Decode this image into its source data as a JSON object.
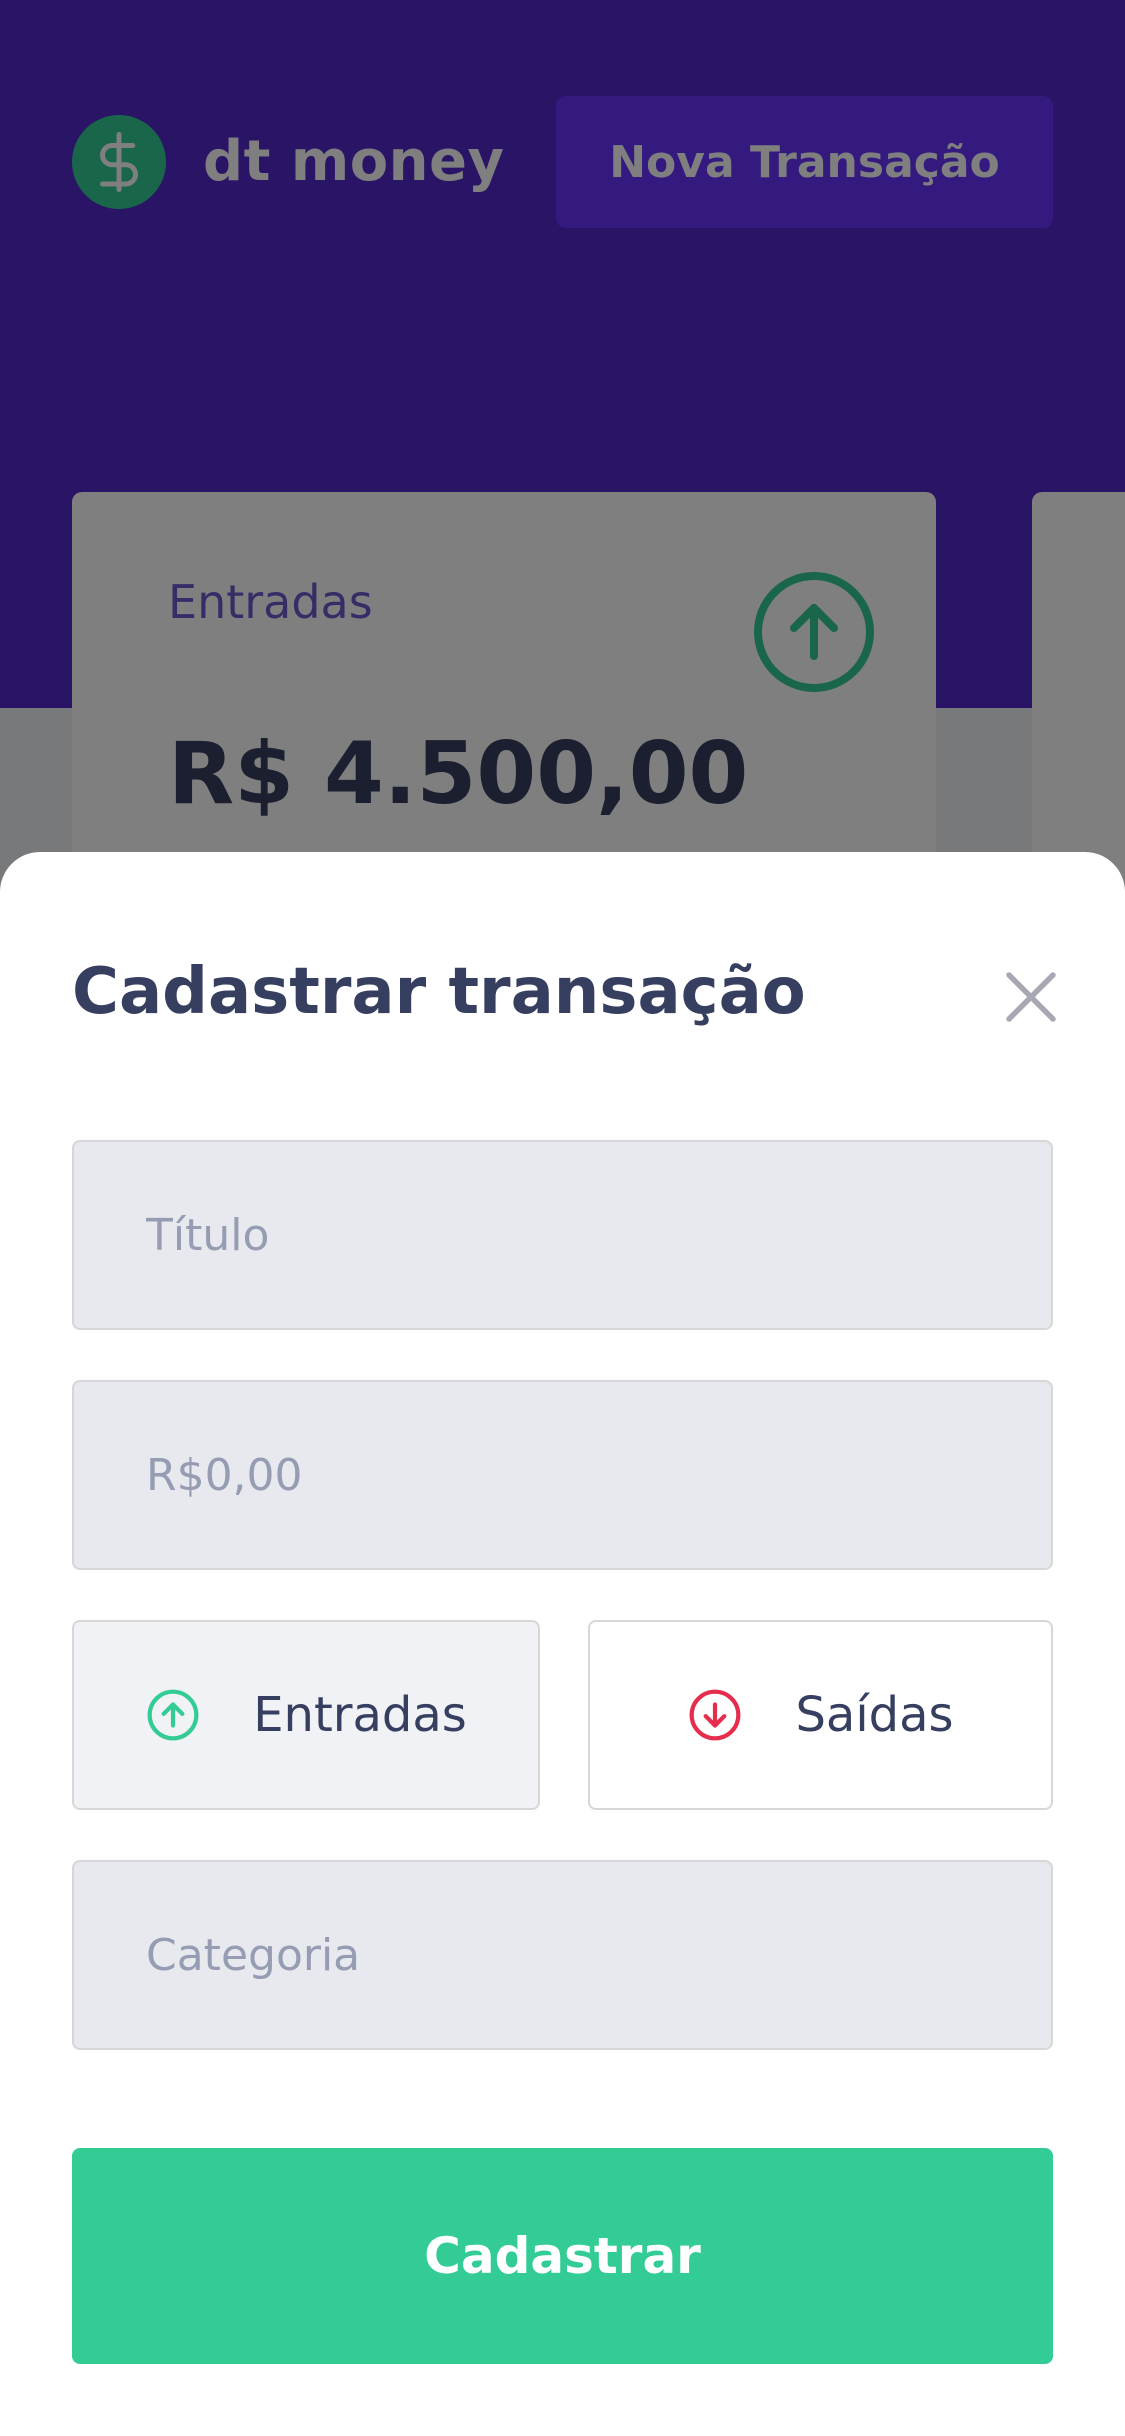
{
  "app": {
    "logo_icon": "dollar-sign-icon",
    "name": "dt money",
    "new_transaction_label": "Nova Transação"
  },
  "summary": {
    "income_label": "Entradas",
    "income_icon": "arrow-up-circle-icon",
    "income_value": "R$ 4.500,00"
  },
  "modal": {
    "title": "Cadastrar transação",
    "close_icon": "close-icon",
    "title_placeholder": "Título",
    "amount_placeholder": "R$0,00",
    "type_income_label": "Entradas",
    "type_income_icon": "arrow-up-circle-icon",
    "type_outcome_label": "Saídas",
    "type_outcome_icon": "arrow-down-circle-icon",
    "category_placeholder": "Categoria",
    "submit_label": "Cadastrar"
  },
  "colors": {
    "brand_purple": "#5429cc",
    "button_purple": "#6933ff",
    "green": "#33cc95",
    "red": "#e52e4d",
    "title_text": "#363f5f",
    "placeholder": "#969cb2"
  }
}
